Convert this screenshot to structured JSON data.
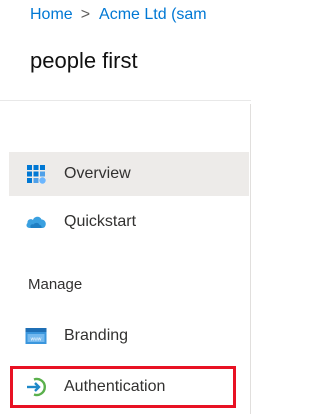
{
  "breadcrumb": {
    "home": "Home",
    "separator": ">",
    "current": "Acme Ltd (sam"
  },
  "page": {
    "title": "people first"
  },
  "nav": {
    "items": [
      {
        "label": "Overview",
        "icon": "overview-grid-icon",
        "selected": true
      },
      {
        "label": "Quickstart",
        "icon": "cloud-icon",
        "selected": false
      }
    ],
    "section_manage": "Manage",
    "manage_items": [
      {
        "label": "Branding",
        "icon": "branding-window-icon"
      },
      {
        "label": "Authentication",
        "icon": "authentication-arrow-icon"
      }
    ]
  },
  "colors": {
    "accent": "#0078d4",
    "highlight": "#e81123",
    "selected_bg": "#edebe9"
  }
}
